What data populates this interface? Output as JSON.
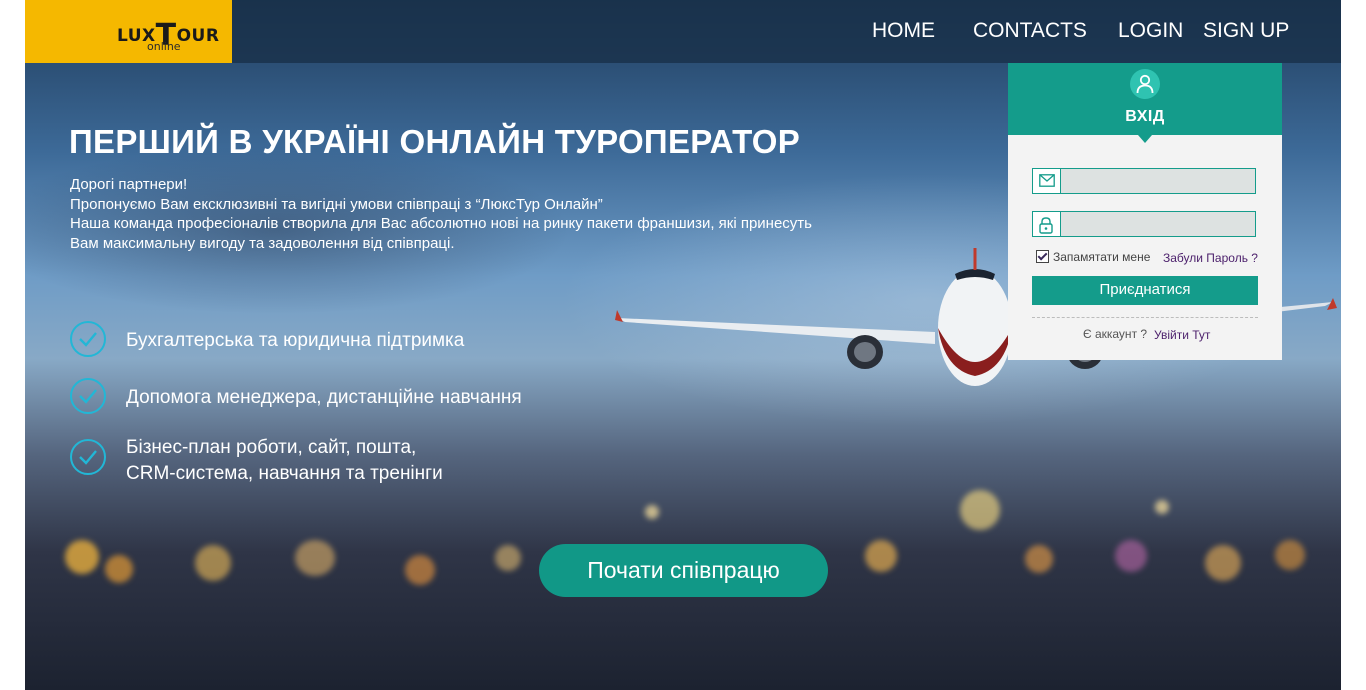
{
  "logo": {
    "lux": "LUX",
    "t": "T",
    "our": "OUR",
    "online": "online"
  },
  "nav": {
    "home": "HOME",
    "contacts": "CONTACTS",
    "login": "LOGIN",
    "signup": "SIGN UP"
  },
  "hero": {
    "title": "ПЕРШИЙ В УКРАЇНІ ОНЛАЙН ТУРОПЕРАТОР",
    "intro": [
      "Дорогі партнери!",
      "Пропонуємо Вам ексклюзивні та вигідні умови співпраці з “ЛюксТур Онлайн”",
      "Наша команда професіоналів створила для Вас абсолютно нові на ринку пакети франшизи, які принесуть",
      "Вам максимальну вигоду та задоволення від співпраці."
    ],
    "features": [
      [
        "Бухгалтерська та юридична підтримка"
      ],
      [
        "Допомога менеджера, дистанційне навчання"
      ],
      [
        "Бізнес-план роботи, сайт, пошта,",
        "CRM-система, навчання та тренінги"
      ]
    ],
    "cta": "Почати співпрацю"
  },
  "login": {
    "title": "ВХІД",
    "email_value": "",
    "password_value": "",
    "remember_checked": true,
    "remember_label": "Запамятати мене",
    "forgot": "Забули Пароль ?",
    "join_button": "Приєднатися",
    "account_text": "Є аккаунт ?",
    "enter_link": "Увійти Тут"
  },
  "colors": {
    "accent": "#149c8b",
    "logo_bg": "#f5b800",
    "check": "#22b7d6",
    "link": "#4b1f6b"
  },
  "icons": [
    "check-circle-icon",
    "user-icon",
    "envelope-icon",
    "lock-icon",
    "checkbox-icon"
  ]
}
